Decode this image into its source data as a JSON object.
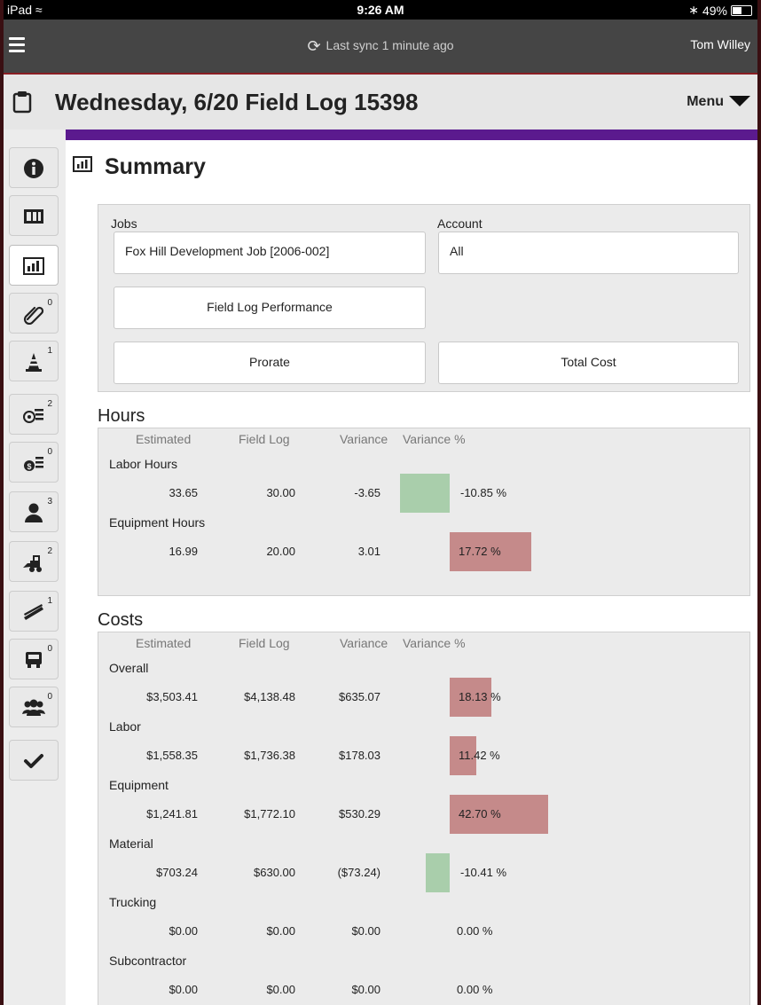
{
  "status_bar": {
    "device": "iPad",
    "time": "9:26 AM",
    "battery": "49%",
    "battery_level": 0.49
  },
  "top_nav": {
    "sync_text": "Last sync 1 minute ago",
    "user_name": "Tom Willey"
  },
  "title_bar": {
    "title": "Wednesday, 6/20 Field Log 15398",
    "menu_label": "Menu"
  },
  "sidebar": {
    "items": [
      {
        "name": "info",
        "badge": ""
      },
      {
        "name": "timesheet",
        "badge": ""
      },
      {
        "name": "summary",
        "badge": "",
        "active": true
      },
      {
        "name": "attachments",
        "badge": "0"
      },
      {
        "name": "safety",
        "badge": "1"
      },
      {
        "name": "production",
        "badge": "2"
      },
      {
        "name": "costs",
        "badge": "0"
      },
      {
        "name": "employees",
        "badge": "3"
      },
      {
        "name": "equipment",
        "badge": "2"
      },
      {
        "name": "materials",
        "badge": "1"
      },
      {
        "name": "trucking",
        "badge": "0"
      },
      {
        "name": "subcontractors",
        "badge": "0"
      },
      {
        "name": "approve",
        "badge": ""
      }
    ]
  },
  "summary": {
    "title": "Summary",
    "jobs_label": "Jobs",
    "job_value": "Fox Hill Development Job [2006-002]",
    "account_label": "Account",
    "account_value": "All",
    "performance_button": "Field Log Performance",
    "prorate_button": "Prorate",
    "total_cost_button": "Total Cost"
  },
  "columns": {
    "estimated": "Estimated",
    "field_log": "Field Log",
    "variance": "Variance",
    "variance_pct": "Variance %"
  },
  "hours": {
    "title": "Hours",
    "rows": [
      {
        "label": "Labor Hours",
        "estimated": "33.65",
        "field_log": "30.00",
        "variance": "-3.65",
        "variance_pct": "-10.85 %",
        "pct_value": -10.85
      },
      {
        "label": "Equipment Hours",
        "estimated": "16.99",
        "field_log": "20.00",
        "variance": "3.01",
        "variance_pct": "17.72 %",
        "pct_value": 17.72
      }
    ]
  },
  "costs": {
    "title": "Costs",
    "rows": [
      {
        "label": "Overall",
        "estimated": "$3,503.41",
        "field_log": "$4,138.48",
        "variance": "$635.07",
        "variance_pct": "18.13 %",
        "pct_value": 18.13
      },
      {
        "label": "Labor",
        "estimated": "$1,558.35",
        "field_log": "$1,736.38",
        "variance": "$178.03",
        "variance_pct": "11.42 %",
        "pct_value": 11.42
      },
      {
        "label": "Equipment",
        "estimated": "$1,241.81",
        "field_log": "$1,772.10",
        "variance": "$530.29",
        "variance_pct": "42.70 %",
        "pct_value": 42.7
      },
      {
        "label": "Material",
        "estimated": "$703.24",
        "field_log": "$630.00",
        "variance": "($73.24)",
        "variance_pct": "-10.41 %",
        "pct_value": -10.41
      },
      {
        "label": "Trucking",
        "estimated": "$0.00",
        "field_log": "$0.00",
        "variance": "$0.00",
        "variance_pct": "0.00 %",
        "pct_value": 0
      },
      {
        "label": "Subcontractor",
        "estimated": "$0.00",
        "field_log": "$0.00",
        "variance": "$0.00",
        "variance_pct": "0.00 %",
        "pct_value": 0
      }
    ]
  },
  "colors": {
    "accent": "#5b1a8e",
    "over_budget": "#c58a8a",
    "under_budget": "#a9ceab",
    "nav_bg": "#454545"
  }
}
